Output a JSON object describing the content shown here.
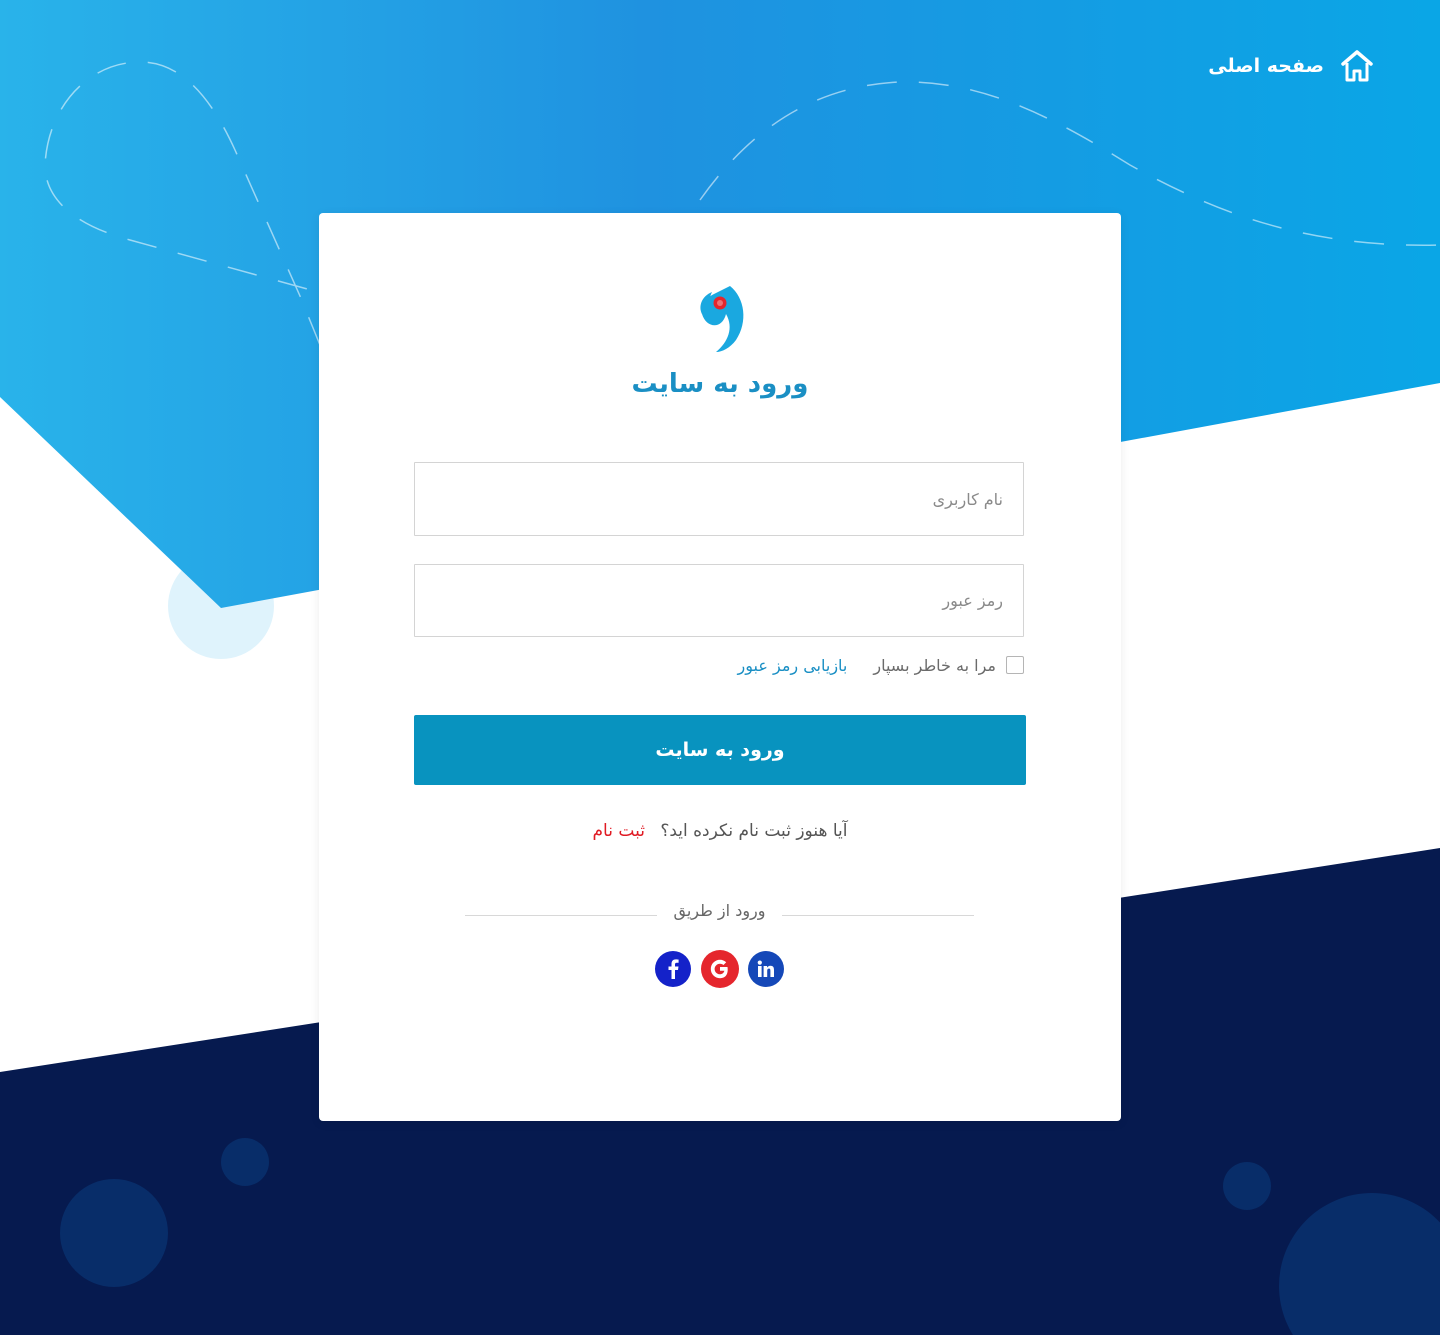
{
  "header": {
    "home_label": "صفحه اصلی",
    "home_icon": "home-icon"
  },
  "login": {
    "logo_icon": "brand-logo",
    "title": "ورود به سایت",
    "username_placeholder": "نام کاربری",
    "username_value": "",
    "password_placeholder": "رمز عبور",
    "password_value": "",
    "remember_label": "مرا به خاطر بسپار",
    "remember_checked": false,
    "forgot_label": "بازیابی رمز عبور",
    "submit_label": "ورود به سایت",
    "signup_question": "آیا هنوز ثبت نام نکرده اید؟",
    "signup_link": "ثبت نام",
    "social_divider": "ورود از طریق",
    "social": [
      {
        "name": "facebook",
        "icon": "facebook-icon",
        "color": "#1422c9"
      },
      {
        "name": "google",
        "icon": "google-icon",
        "color": "#e5262d"
      },
      {
        "name": "linkedin",
        "icon": "linkedin-icon",
        "color": "#1548b8"
      }
    ]
  },
  "colors": {
    "primary": "#0893bf",
    "title": "#1a8fc4",
    "link_red": "#e01b24",
    "navy": "#061a4f",
    "sky_start": "#29b3ea",
    "sky_end": "#0aa6e6"
  }
}
